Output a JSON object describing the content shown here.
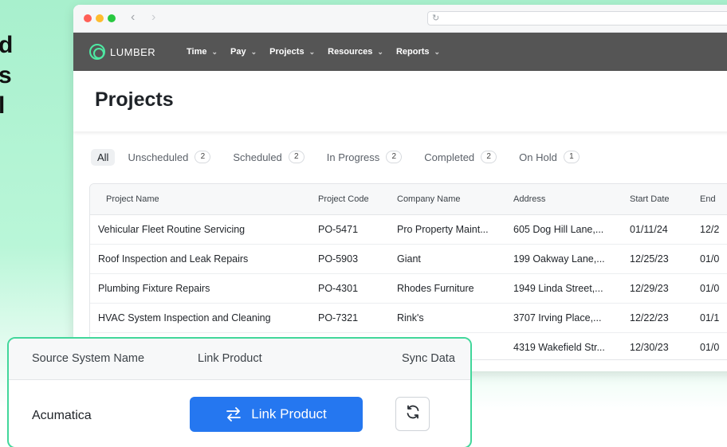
{
  "background_text": [
    "d",
    "s",
    "l"
  ],
  "browser": {
    "url": ""
  },
  "app": {
    "brand": "LUMBER",
    "menu": [
      {
        "label": "Time"
      },
      {
        "label": "Pay"
      },
      {
        "label": "Projects"
      },
      {
        "label": "Resources"
      },
      {
        "label": "Reports"
      }
    ]
  },
  "page": {
    "title": "Projects",
    "tabs": [
      {
        "label": "All",
        "count": ""
      },
      {
        "label": "Unscheduled",
        "count": "2"
      },
      {
        "label": "Scheduled",
        "count": "2"
      },
      {
        "label": "In Progress",
        "count": "2"
      },
      {
        "label": "Completed",
        "count": "2"
      },
      {
        "label": "On Hold",
        "count": "1"
      }
    ],
    "table": {
      "headers": [
        "Project Name",
        "Project Code",
        "Company Name",
        "Address",
        "Start Date",
        "End"
      ],
      "rows": [
        [
          "Vehicular Fleet Routine Servicing",
          "PO-5471",
          "Pro Property Maint...",
          "605 Dog Hill Lane,...",
          "01/11/24",
          "12/2"
        ],
        [
          "Roof Inspection and Leak Repairs",
          "PO-5903",
          "Giant",
          "199 Oakway Lane,...",
          "12/25/23",
          "01/0"
        ],
        [
          "Plumbing Fixture Repairs",
          "PO-4301",
          "Rhodes Furniture",
          "1949 Linda Street,...",
          "12/29/23",
          "01/0"
        ],
        [
          "HVAC System Inspection and Cleaning",
          "PO-7321",
          "Rink's",
          "3707 Irving Place,...",
          "12/22/23",
          "01/1"
        ],
        [
          "",
          "",
          "",
          "4319 Wakefield Str...",
          "12/30/23",
          "01/0"
        ]
      ]
    }
  },
  "sync_card": {
    "headers": {
      "source": "Source System Name",
      "link": "Link Product",
      "sync": "Sync Data"
    },
    "source_value": "Acumatica",
    "link_button": "Link Product"
  },
  "colors": {
    "accent_green": "#42d79b",
    "button_blue": "#2577f0",
    "nav_bg": "#555555"
  }
}
